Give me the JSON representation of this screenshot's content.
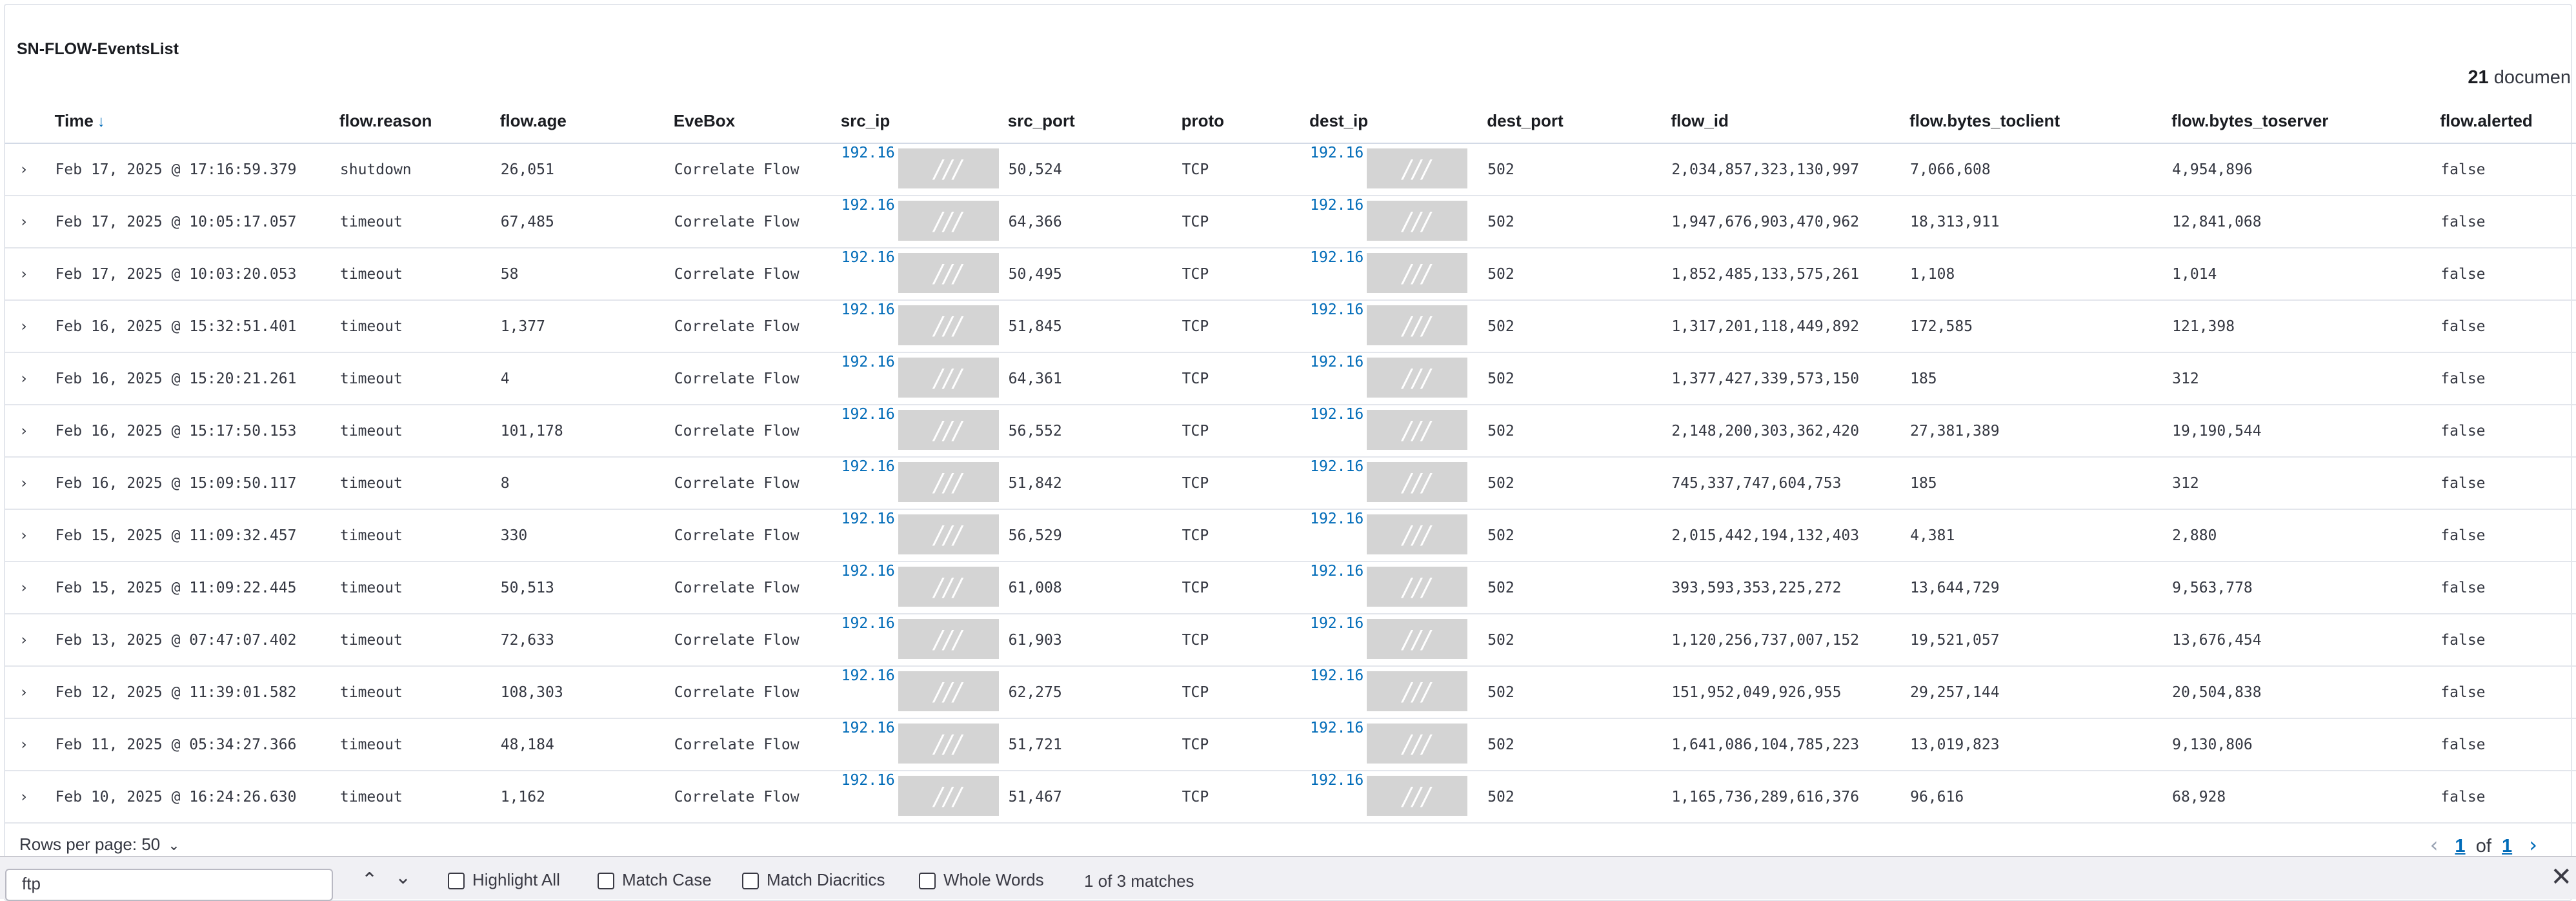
{
  "panel": {
    "title": "SN-FLOW-EventsList",
    "doc_count_number": "21",
    "doc_count_label": "documen"
  },
  "columns": [
    "Time",
    "flow.reason",
    "flow.age",
    "EveBox",
    "src_ip",
    "src_port",
    "proto",
    "dest_ip",
    "dest_port",
    "flow_id",
    "flow.bytes_toclient",
    "flow.bytes_toserver",
    "flow.alerted"
  ],
  "sort_indicator": "↓",
  "redaction_glyph": "///",
  "rows": [
    {
      "time": "Feb 17, 2025 @ 17:16:59.379",
      "reason": "shutdown",
      "age": "26,051",
      "evebox": "Correlate Flow",
      "src_ip": "192.16",
      "src_port": "50,524",
      "proto": "TCP",
      "dest_ip": "192.16",
      "dest_port": "502",
      "flow_id": "2,034,857,323,130,997",
      "toclient": "7,066,608",
      "toserver": "4,954,896",
      "alerted": "false"
    },
    {
      "time": "Feb 17, 2025 @ 10:05:17.057",
      "reason": "timeout",
      "age": "67,485",
      "evebox": "Correlate Flow",
      "src_ip": "192.16",
      "src_port": "64,366",
      "proto": "TCP",
      "dest_ip": "192.16",
      "dest_port": "502",
      "flow_id": "1,947,676,903,470,962",
      "toclient": "18,313,911",
      "toserver": "12,841,068",
      "alerted": "false"
    },
    {
      "time": "Feb 17, 2025 @ 10:03:20.053",
      "reason": "timeout",
      "age": "58",
      "evebox": "Correlate Flow",
      "src_ip": "192.16",
      "src_port": "50,495",
      "proto": "TCP",
      "dest_ip": "192.16",
      "dest_port": "502",
      "flow_id": "1,852,485,133,575,261",
      "toclient": "1,108",
      "toserver": "1,014",
      "alerted": "false"
    },
    {
      "time": "Feb 16, 2025 @ 15:32:51.401",
      "reason": "timeout",
      "age": "1,377",
      "evebox": "Correlate Flow",
      "src_ip": "192.16",
      "src_port": "51,845",
      "proto": "TCP",
      "dest_ip": "192.16",
      "dest_port": "502",
      "flow_id": "1,317,201,118,449,892",
      "toclient": "172,585",
      "toserver": "121,398",
      "alerted": "false"
    },
    {
      "time": "Feb 16, 2025 @ 15:20:21.261",
      "reason": "timeout",
      "age": "4",
      "evebox": "Correlate Flow",
      "src_ip": "192.16",
      "src_port": "64,361",
      "proto": "TCP",
      "dest_ip": "192.16",
      "dest_port": "502",
      "flow_id": "1,377,427,339,573,150",
      "toclient": "185",
      "toserver": "312",
      "alerted": "false"
    },
    {
      "time": "Feb 16, 2025 @ 15:17:50.153",
      "reason": "timeout",
      "age": "101,178",
      "evebox": "Correlate Flow",
      "src_ip": "192.16",
      "src_port": "56,552",
      "proto": "TCP",
      "dest_ip": "192.16",
      "dest_port": "502",
      "flow_id": "2,148,200,303,362,420",
      "toclient": "27,381,389",
      "toserver": "19,190,544",
      "alerted": "false"
    },
    {
      "time": "Feb 16, 2025 @ 15:09:50.117",
      "reason": "timeout",
      "age": "8",
      "evebox": "Correlate Flow",
      "src_ip": "192.16",
      "src_port": "51,842",
      "proto": "TCP",
      "dest_ip": "192.16",
      "dest_port": "502",
      "flow_id": "745,337,747,604,753",
      "toclient": "185",
      "toserver": "312",
      "alerted": "false"
    },
    {
      "time": "Feb 15, 2025 @ 11:09:32.457",
      "reason": "timeout",
      "age": "330",
      "evebox": "Correlate Flow",
      "src_ip": "192.16",
      "src_port": "56,529",
      "proto": "TCP",
      "dest_ip": "192.16",
      "dest_port": "502",
      "flow_id": "2,015,442,194,132,403",
      "toclient": "4,381",
      "toserver": "2,880",
      "alerted": "false"
    },
    {
      "time": "Feb 15, 2025 @ 11:09:22.445",
      "reason": "timeout",
      "age": "50,513",
      "evebox": "Correlate Flow",
      "src_ip": "192.16",
      "src_port": "61,008",
      "proto": "TCP",
      "dest_ip": "192.16",
      "dest_port": "502",
      "flow_id": "393,593,353,225,272",
      "toclient": "13,644,729",
      "toserver": "9,563,778",
      "alerted": "false"
    },
    {
      "time": "Feb 13, 2025 @ 07:47:07.402",
      "reason": "timeout",
      "age": "72,633",
      "evebox": "Correlate Flow",
      "src_ip": "192.16",
      "src_port": "61,903",
      "proto": "TCP",
      "dest_ip": "192.16",
      "dest_port": "502",
      "flow_id": "1,120,256,737,007,152",
      "toclient": "19,521,057",
      "toserver": "13,676,454",
      "alerted": "false"
    },
    {
      "time": "Feb 12, 2025 @ 11:39:01.582",
      "reason": "timeout",
      "age": "108,303",
      "evebox": "Correlate Flow",
      "src_ip": "192.16",
      "src_port": "62,275",
      "proto": "TCP",
      "dest_ip": "192.16",
      "dest_port": "502",
      "flow_id": "151,952,049,926,955",
      "toclient": "29,257,144",
      "toserver": "20,504,838",
      "alerted": "false"
    },
    {
      "time": "Feb 11, 2025 @ 05:34:27.366",
      "reason": "timeout",
      "age": "48,184",
      "evebox": "Correlate Flow",
      "src_ip": "192.16",
      "src_port": "51,721",
      "proto": "TCP",
      "dest_ip": "192.16",
      "dest_port": "502",
      "flow_id": "1,641,086,104,785,223",
      "toclient": "13,019,823",
      "toserver": "9,130,806",
      "alerted": "false"
    },
    {
      "time": "Feb 10, 2025 @ 16:24:26.630",
      "reason": "timeout",
      "age": "1,162",
      "evebox": "Correlate Flow",
      "src_ip": "192.16",
      "src_port": "51,467",
      "proto": "TCP",
      "dest_ip": "192.16",
      "dest_port": "502",
      "flow_id": "1,165,736,289,616,376",
      "toclient": "96,616",
      "toserver": "68,928",
      "alerted": "false"
    }
  ],
  "footer": {
    "rows_per_page": "Rows per page: 50",
    "page_current": "1",
    "page_of": "of",
    "page_total": "1"
  },
  "findbar": {
    "query": "ftp",
    "highlight_all": "Highlight All",
    "match_case": "Match Case",
    "match_diacritics": "Match Diacritics",
    "whole_words": "Whole Words",
    "status": "1 of 3 matches"
  },
  "colors": {
    "link": "#006bb8",
    "redaction": "#d4d4d4",
    "border": "#e3e6ec"
  }
}
